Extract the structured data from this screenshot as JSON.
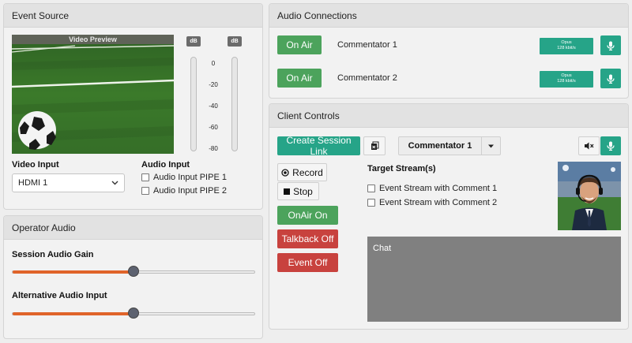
{
  "event_source": {
    "title": "Event Source",
    "video_preview_label": "Video Preview",
    "db_label": "dB",
    "db_ticks": [
      "0",
      "-20",
      "-40",
      "-60",
      "-80"
    ],
    "video_input_label": "Video Input",
    "video_input_value": "HDMI 1",
    "audio_input_label": "Audio Input",
    "audio_inputs": [
      "Audio Input PIPE 1",
      "Audio Input PIPE 2"
    ]
  },
  "operator_audio": {
    "title": "Operator Audio",
    "sliders": [
      {
        "label": "Session Audio Gain",
        "value": 0.5
      },
      {
        "label": "Alternative Audio Input",
        "value": 0.5
      }
    ]
  },
  "audio_connections": {
    "title": "Audio Connections",
    "rows": [
      {
        "status": "On Air",
        "name": "Commentator 1",
        "codec": "Opus",
        "bitrate": "128 kbit/s"
      },
      {
        "status": "On Air",
        "name": "Commentator 2",
        "codec": "Opus",
        "bitrate": "128 kbit/s"
      }
    ]
  },
  "client_controls": {
    "title": "Client Controls",
    "create_session_label": "Create Session Link",
    "commentator_select": "Commentator 1",
    "record_label": "Record",
    "stop_label": "Stop",
    "onair_label": "OnAir On",
    "talkback_label": "Talkback Off",
    "event_label": "Event Off",
    "target_streams_label": "Target Stream(s)",
    "target_streams": [
      "Event Stream with Comment 1",
      "Event Stream with Comment 2"
    ],
    "chat_label": "Chat"
  },
  "colors": {
    "green": "#4ca35c",
    "teal": "#26a488",
    "red": "#c8423e",
    "slider_fill": "#e0642a"
  }
}
